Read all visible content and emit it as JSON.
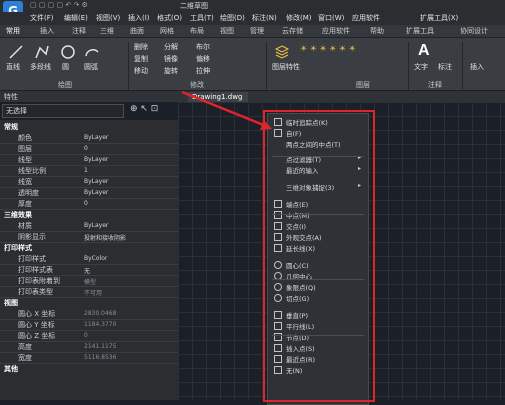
{
  "title_bar": {
    "quick_access": "文件"
  },
  "menus": [
    "文件(F)",
    "编辑(E)",
    "视图(V)",
    "插入(I)",
    "格式(O)",
    "工具(T)",
    "绘图(D)",
    "标注(N)",
    "修改(M)",
    "窗口(W)",
    "应用软件",
    "扩展工具(X)"
  ],
  "title": "二维草图",
  "ribbon_tabs": [
    "常用",
    "插入",
    "注释",
    "三维",
    "曲面",
    "网格",
    "布局",
    "视图",
    "管理",
    "云存储",
    "应用软件",
    "帮助",
    "扩展工具",
    "协同设计"
  ],
  "draw_tools": [
    "直线",
    "多段线",
    "圆",
    "圆弧"
  ],
  "modify_tools": [
    {
      "label": "删除",
      "label2": "分解"
    },
    {
      "label": "复制",
      "label2": "镜像"
    },
    {
      "label": "移动",
      "label2": "旋转"
    }
  ],
  "modify_more": [
    "布尔",
    "偏移",
    "拉伸",
    "缩放"
  ],
  "layer_tools": [
    "图层特性"
  ],
  "annot_tools": [
    "文字",
    "标注"
  ],
  "insert_tool": "插入",
  "group_labels": {
    "draw": "绘图",
    "modify": "修改",
    "layer": "图层",
    "annotate": "注释",
    "block": "块"
  },
  "panel": {
    "title": "特性",
    "selection": "无选择",
    "sections": [
      {
        "name": "常规",
        "rows": [
          {
            "k": "颜色",
            "v": "ByLayer"
          },
          {
            "k": "图层",
            "v": "0"
          },
          {
            "k": "线型",
            "v": "ByLayer"
          },
          {
            "k": "线型比例",
            "v": "1"
          },
          {
            "k": "线宽",
            "v": "ByLayer"
          },
          {
            "k": "透明度",
            "v": "ByLayer"
          },
          {
            "k": "厚度",
            "v": "0"
          }
        ]
      },
      {
        "name": "三维效果",
        "rows": [
          {
            "k": "材质",
            "v": "ByLayer"
          },
          {
            "k": "阴影显示",
            "v": "投射和接收阴影"
          }
        ]
      },
      {
        "name": "打印样式",
        "rows": [
          {
            "k": "打印样式",
            "v": "ByColor"
          },
          {
            "k": "打印样式表",
            "v": "无"
          },
          {
            "k": "打印表附着到",
            "v": "模型"
          },
          {
            "k": "打印表类型",
            "v": "不可用"
          }
        ]
      },
      {
        "name": "视图",
        "rows": [
          {
            "k": "圆心 X 坐标",
            "v": "2830.0468"
          },
          {
            "k": "圆心 Y 坐标",
            "v": "1184.3770"
          },
          {
            "k": "圆心 Z 坐标",
            "v": "0"
          },
          {
            "k": "高度",
            "v": "2141.1175"
          },
          {
            "k": "宽度",
            "v": "5116.8536"
          }
        ]
      },
      {
        "name": "其他",
        "rows": []
      }
    ]
  },
  "doc_tab": "Drawing1.dwg",
  "context_menu": [
    {
      "label": "临时追踪点(K)",
      "icon": "track-icon"
    },
    {
      "label": "自(F)",
      "icon": "from-icon"
    },
    {
      "label": "两点之间的中点(T)",
      "icon": ""
    },
    {
      "label": "点过滤器(T)",
      "icon": "",
      "sub": true
    },
    {
      "label": "最近的输入",
      "icon": "",
      "sub": true
    },
    {
      "label": "三维对象捕捉(3)",
      "icon": "",
      "sub": true
    },
    {
      "label": "端点(E)",
      "icon": "endpoint-icon"
    },
    {
      "label": "中点(M)",
      "icon": "midpoint-icon"
    },
    {
      "label": "交点(I)",
      "icon": "intersection-icon"
    },
    {
      "label": "外观交点(A)",
      "icon": "apparent-intersection-icon"
    },
    {
      "label": "延长线(X)",
      "icon": "extension-icon"
    },
    {
      "label": "圆心(C)",
      "icon": "center-icon"
    },
    {
      "label": "几何中心",
      "icon": "geometric-center-icon"
    },
    {
      "label": "象限点(Q)",
      "icon": "quadrant-icon"
    },
    {
      "label": "切点(G)",
      "icon": "tangent-icon"
    },
    {
      "label": "垂直(P)",
      "icon": "perpendicular-icon"
    },
    {
      "label": "平行线(L)",
      "icon": "parallel-icon"
    },
    {
      "label": "节点(D)",
      "icon": "node-icon"
    },
    {
      "label": "插入点(S)",
      "icon": "insert-icon"
    },
    {
      "label": "最近点(R)",
      "icon": "nearest-icon"
    },
    {
      "label": "无(N)",
      "icon": "none-icon"
    }
  ],
  "colors": {
    "accent": "#e0242a",
    "menu_bg": "#2e3136"
  }
}
